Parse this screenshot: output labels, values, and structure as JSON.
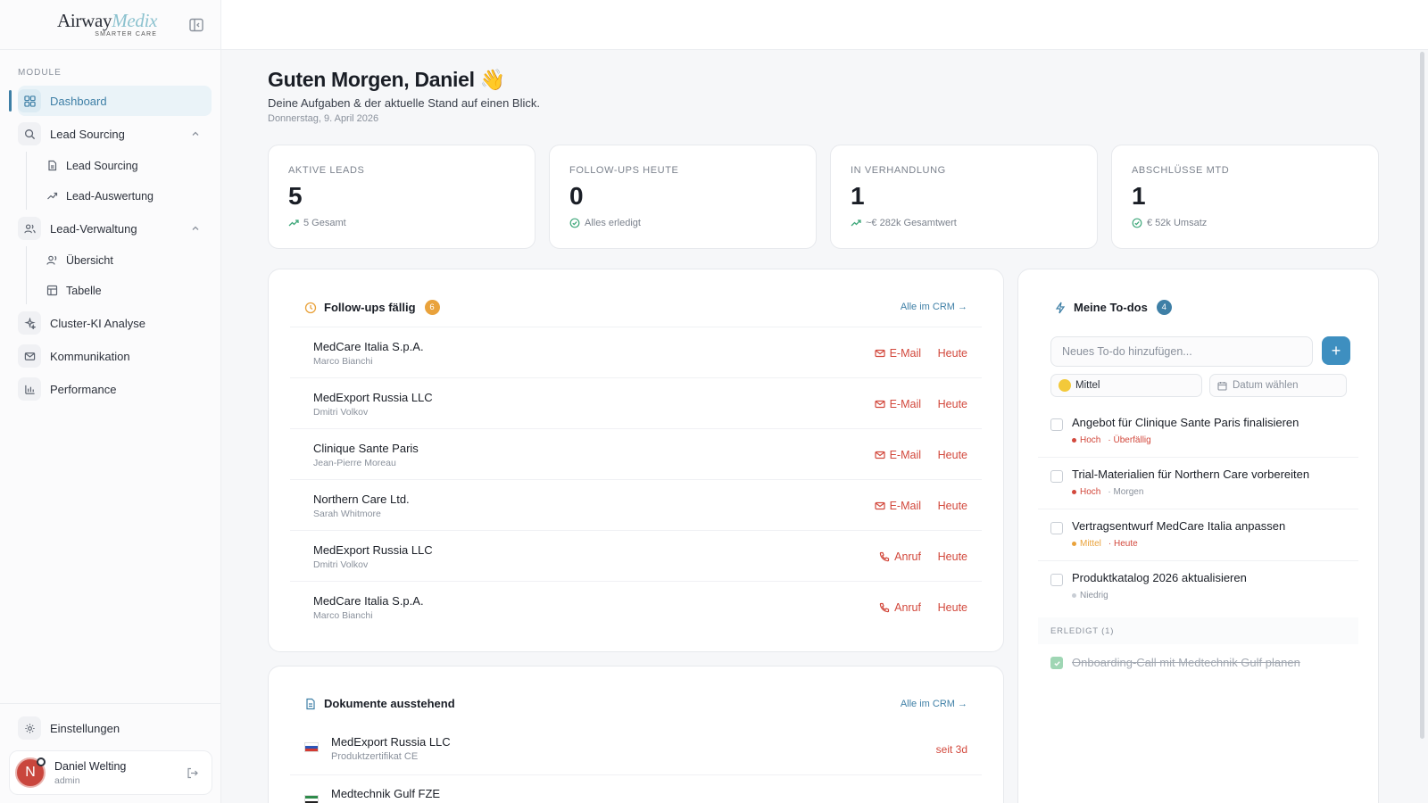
{
  "brand": {
    "name_a": "Airway",
    "name_b": "Medix",
    "tagline": "SMARTER CARE"
  },
  "sidebar": {
    "section_title": "MODULE",
    "dashboard": "Dashboard",
    "lead_sourcing": "Lead Sourcing",
    "lead_sourcing_sub": [
      "Lead Sourcing",
      "Lead-Auswertung"
    ],
    "lead_verwaltung": "Lead-Verwaltung",
    "lead_verwaltung_sub": [
      "Übersicht",
      "Tabelle"
    ],
    "cluster": "Cluster-KI Analyse",
    "kommunikation": "Kommunikation",
    "performance": "Performance",
    "settings": "Einstellungen",
    "user": {
      "initial": "N",
      "name": "Daniel Welting",
      "role": "admin"
    }
  },
  "header": {
    "greeting": "Guten Morgen, Daniel 👋",
    "subtitle": "Deine Aufgaben & der aktuelle Stand auf einen Blick.",
    "date": "Donnerstag, 9. April 2026"
  },
  "stats": [
    {
      "label": "AKTIVE LEADS",
      "value": "5",
      "foot": "5 Gesamt"
    },
    {
      "label": "FOLLOW-UPS HEUTE",
      "value": "0",
      "foot": "Alles erledigt"
    },
    {
      "label": "IN VERHANDLUNG",
      "value": "1",
      "foot": "~€ 282k Gesamtwert"
    },
    {
      "label": "ABSCHLÜSSE MTD",
      "value": "1",
      "foot": "€ 52k Umsatz"
    }
  ],
  "followups": {
    "title": "Follow-ups fällig",
    "count": "6",
    "link": "Alle im CRM →",
    "rows": [
      {
        "company": "MedCare Italia S.p.A.",
        "contact": "Marco Bianchi",
        "type": "E-Mail",
        "when": "Heute"
      },
      {
        "company": "MedExport Russia LLC",
        "contact": "Dmitri Volkov",
        "type": "E-Mail",
        "when": "Heute"
      },
      {
        "company": "Clinique Sante Paris",
        "contact": "Jean-Pierre Moreau",
        "type": "E-Mail",
        "when": "Heute"
      },
      {
        "company": "Northern Care Ltd.",
        "contact": "Sarah Whitmore",
        "type": "E-Mail",
        "when": "Heute"
      },
      {
        "company": "MedExport Russia LLC",
        "contact": "Dmitri Volkov",
        "type": "Anruf",
        "when": "Heute"
      },
      {
        "company": "MedCare Italia S.p.A.",
        "contact": "Marco Bianchi",
        "type": "Anruf",
        "when": "Heute"
      }
    ]
  },
  "documents": {
    "title": "Dokumente ausstehend",
    "link": "Alle im CRM →",
    "rows": [
      {
        "company": "MedExport Russia LLC",
        "doc": "Produktzertifikat CE",
        "age": "seit 3d"
      },
      {
        "company": "Medtechnik Gulf FZE",
        "doc": "",
        "age": ""
      }
    ]
  },
  "todos": {
    "title": "Meine To-dos",
    "count": "4",
    "input_placeholder": "Neues To-do hinzufügen...",
    "add_label": "+",
    "priority_value": "Mittel",
    "date_placeholder": "Datum wählen",
    "items": [
      {
        "title": "Angebot für Clinique Sante Paris finalisieren",
        "prio": "Hoch",
        "due": "· Überfällig"
      },
      {
        "title": "Trial-Materialien für Northern Care vorbereiten",
        "prio": "Hoch",
        "due": "· Morgen"
      },
      {
        "title": "Vertragsentwurf MedCare Italia anpassen",
        "prio": "Mittel",
        "due": "· Heute"
      },
      {
        "title": "Produktkatalog 2026 aktualisieren",
        "prio": "Niedrig",
        "due": ""
      }
    ],
    "done_header": "ERLEDIGT (1)",
    "done_item": "Onboarding-Call mit Medtechnik Gulf planen"
  },
  "colors": {
    "accent": "#3e7fa6",
    "danger": "#d2483c",
    "success": "#3ea77a",
    "warning": "#e9a23b"
  }
}
